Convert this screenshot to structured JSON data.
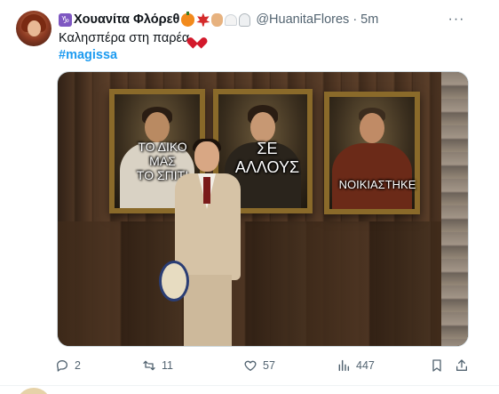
{
  "tweet": {
    "display_name": "Χουανίτα Φλόρεθ",
    "name_badge": "♑",
    "handle": "@HuanitaFlores",
    "separator": "·",
    "time": "5m",
    "more": "···",
    "text": "Καλησπέρα στη παρέα",
    "hashtag": "#magissa"
  },
  "media": {
    "caption_left_lines": [
      "ΤΟ ΔΙΚΟ",
      "ΜΑΣ",
      "ΤΟ ΣΠΙΤΙ"
    ],
    "caption_middle_lines": [
      "ΣΕ",
      "ΑΛΛΟΥΣ"
    ],
    "caption_right": "ΝΟΙΚΙΑΣΤΗΚΕ"
  },
  "actions": {
    "replies": "2",
    "retweets": "11",
    "likes": "57",
    "views": "447"
  },
  "icons": {
    "reply": "reply-icon",
    "retweet": "retweet-icon",
    "like": "heart-icon",
    "views": "analytics-icon",
    "bookmark": "bookmark-icon",
    "share": "share-icon"
  },
  "colors": {
    "link": "#1d9bf0",
    "secondary_text": "#536471",
    "heart_emoji": "#d3192b",
    "capricorn_badge": "#7e57c2"
  }
}
